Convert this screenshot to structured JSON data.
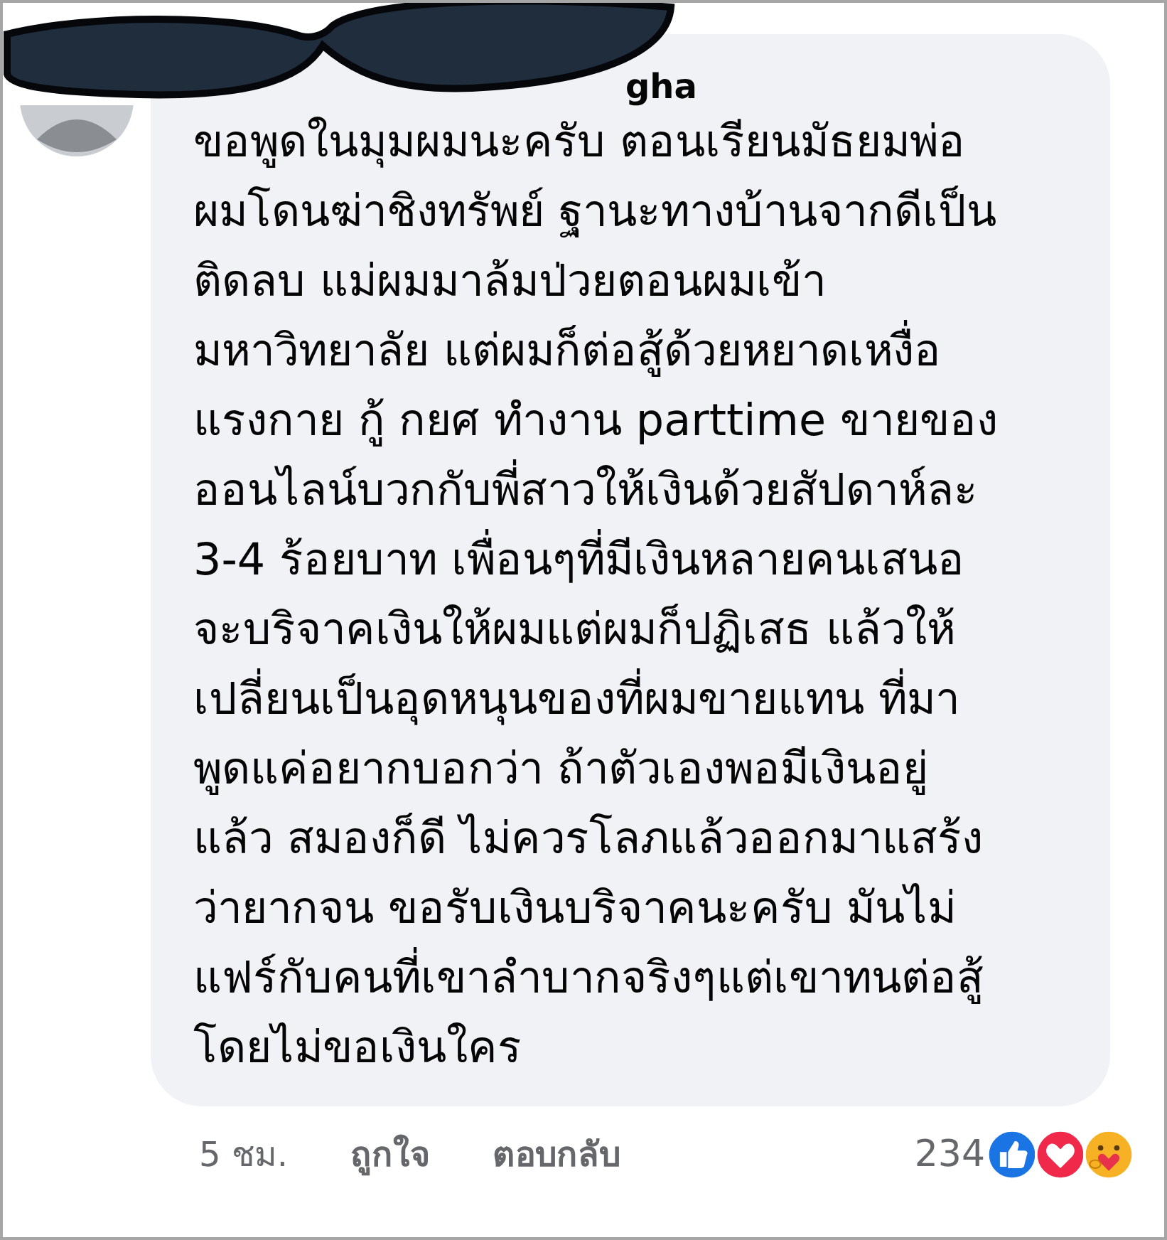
{
  "comment": {
    "author": "gha",
    "lines": [
      "ขอพูดในมุมผมนะครับ ตอนเรียนมัธยมพ่อ",
      "ผมโดนฆ่าชิงทรัพย์ ฐานะทางบ้านจากดีเป็น",
      "ติดลบ แม่ผมมาล้มป่วยตอนผมเข้า",
      "มหาวิทยาลัย แต่ผมก็ต่อสู้ด้วยหยาดเหงื่อ",
      "แรงกาย กู้ กยศ ทำงาน parttime ขายของ",
      "ออนไลน์บวกกับพี่สาวให้เงินด้วยสัปดาห์ละ",
      "3-4 ร้อยบาท  เพื่อนๆที่มีเงินหลายคนเสนอ",
      "จะบริจาคเงินให้ผมแต่ผมก็ปฏิเสธ แล้วให้",
      "เปลี่ยนเป็นอุดหนุนของที่ผมขายแทน ที่มา",
      "พูดแค่อยากบอกว่า ถ้าตัวเองพอมีเงินอยู่",
      "แล้ว สมองก็ดี ไม่ควรโลภแล้วออกมาแสร้ง",
      "ว่ายากจน ขอรับเงินบริจาคนะครับ มันไม่",
      "แฟร์กับคนที่เขาลำบากจริงๆแต่เขาทนต่อสู้",
      "โดยไม่ขอเงินใคร"
    ],
    "time": "5 ชม.",
    "like": "ถูกใจ",
    "reply": "ตอบกลับ",
    "reaction_count": "234",
    "reactions": [
      {
        "kind": "like"
      },
      {
        "kind": "love"
      },
      {
        "kind": "care"
      }
    ]
  }
}
